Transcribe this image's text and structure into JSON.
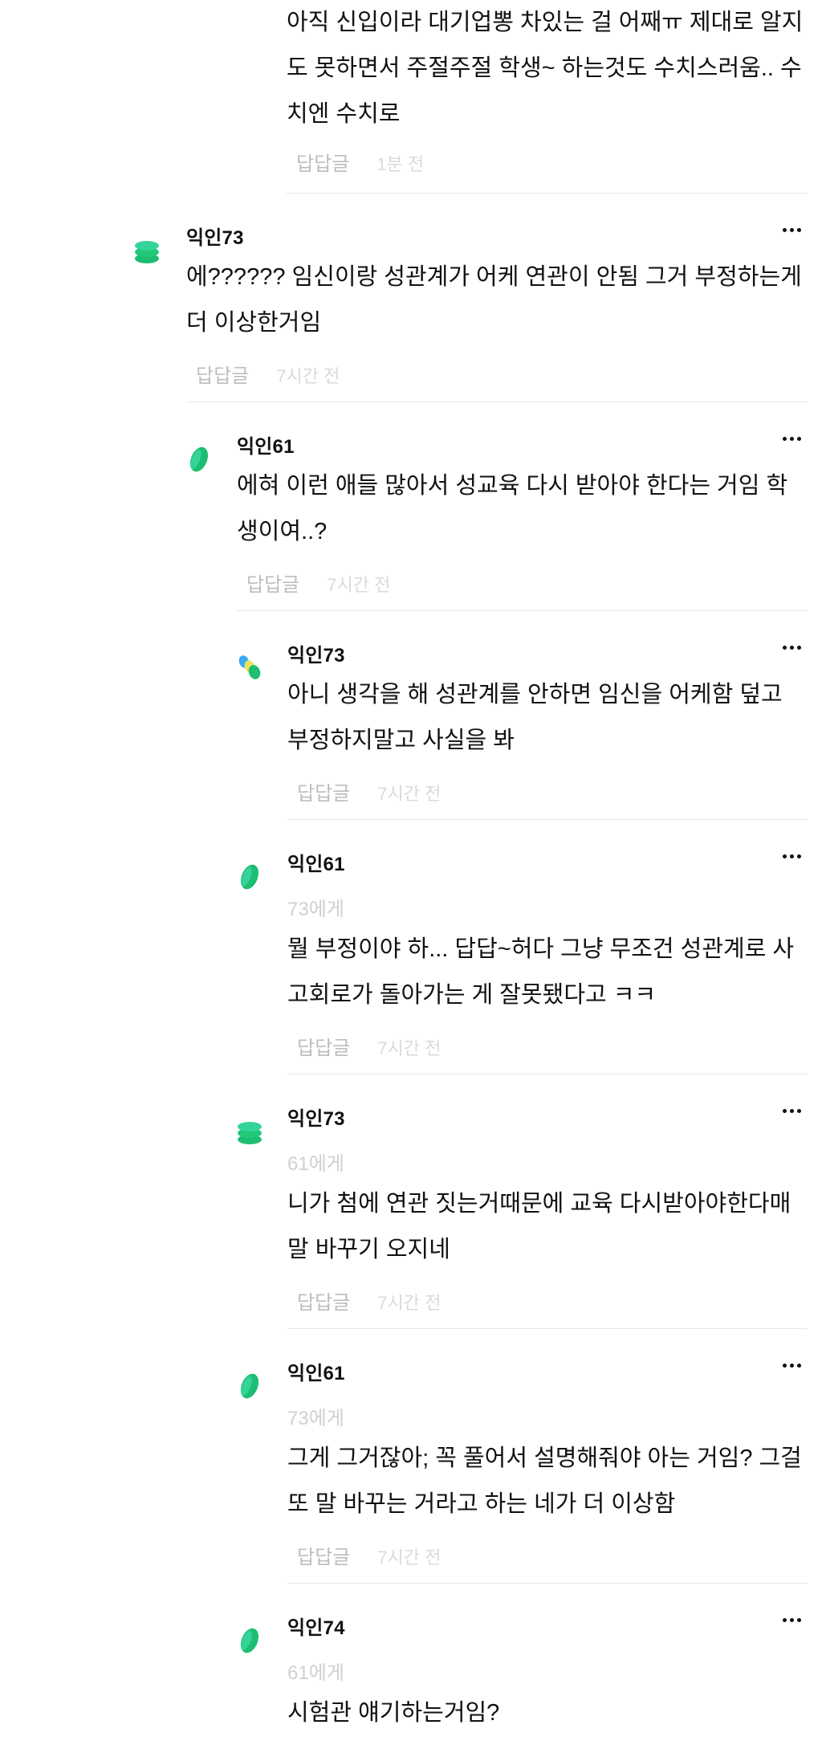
{
  "ui": {
    "reply_label": "답답글"
  },
  "colors": {
    "avatar_green": "#1DBE72",
    "avatar_light_green": "#34D399",
    "avatar_blue": "#3BA9F5",
    "avatar_yellow": "#E8E45A"
  },
  "comments": [
    {
      "text": "아직 신입이라 대기업뽕 차있는 걸 어째ㅠ 제대로 알지도 못하면서 주절주절 학생~ 하는것도 수치스러움.. 수치엔 수치로",
      "time": "1분 전"
    },
    {
      "author": "익인73",
      "text": "에?????? 임신이랑 성관계가 어케 연관이 안됨 그거 부정하는게 더 이상한거임",
      "time": "7시간 전",
      "avatar_icon": "stack-avatar-icon"
    },
    {
      "author": "익인61",
      "text": "에혀 이런 애들 많아서 성교육 다시 받아야 한다는 거임 학생이여..?",
      "time": "7시간 전",
      "avatar_icon": "leaf-avatar-icon"
    },
    {
      "author": "익인73",
      "text": "아니 생각을 해 성관계를 안하면 임신을 어케함 덮고 부정하지말고 사실을 봐",
      "time": "7시간 전",
      "avatar_icon": "cluster-avatar-icon"
    },
    {
      "author": "익인61",
      "mention": "73에게",
      "text": "뭘 부정이야 하... 답답~허다 그냥 무조건 성관계로 사고회로가 돌아가는 게 잘못됐다고 ㅋㅋ",
      "time": "7시간 전",
      "avatar_icon": "leaf-avatar-icon"
    },
    {
      "author": "익인73",
      "mention": "61에게",
      "text": "니가 첨에 연관 짓는거때문에 교육 다시받아야한다매 말 바꾸기 오지네",
      "time": "7시간 전",
      "avatar_icon": "stack-avatar-icon"
    },
    {
      "author": "익인61",
      "mention": "73에게",
      "text": "그게 그거잖아; 꼭 풀어서 설명해줘야 아는 거임? 그걸 또 말 바꾸는 거라고 하는 네가 더 이상함",
      "time": "7시간 전",
      "avatar_icon": "leaf-avatar-icon"
    },
    {
      "author": "익인74",
      "mention": "61에게",
      "text": "시험관 얘기하는거임?",
      "avatar_icon": "leaf-avatar-icon"
    }
  ]
}
